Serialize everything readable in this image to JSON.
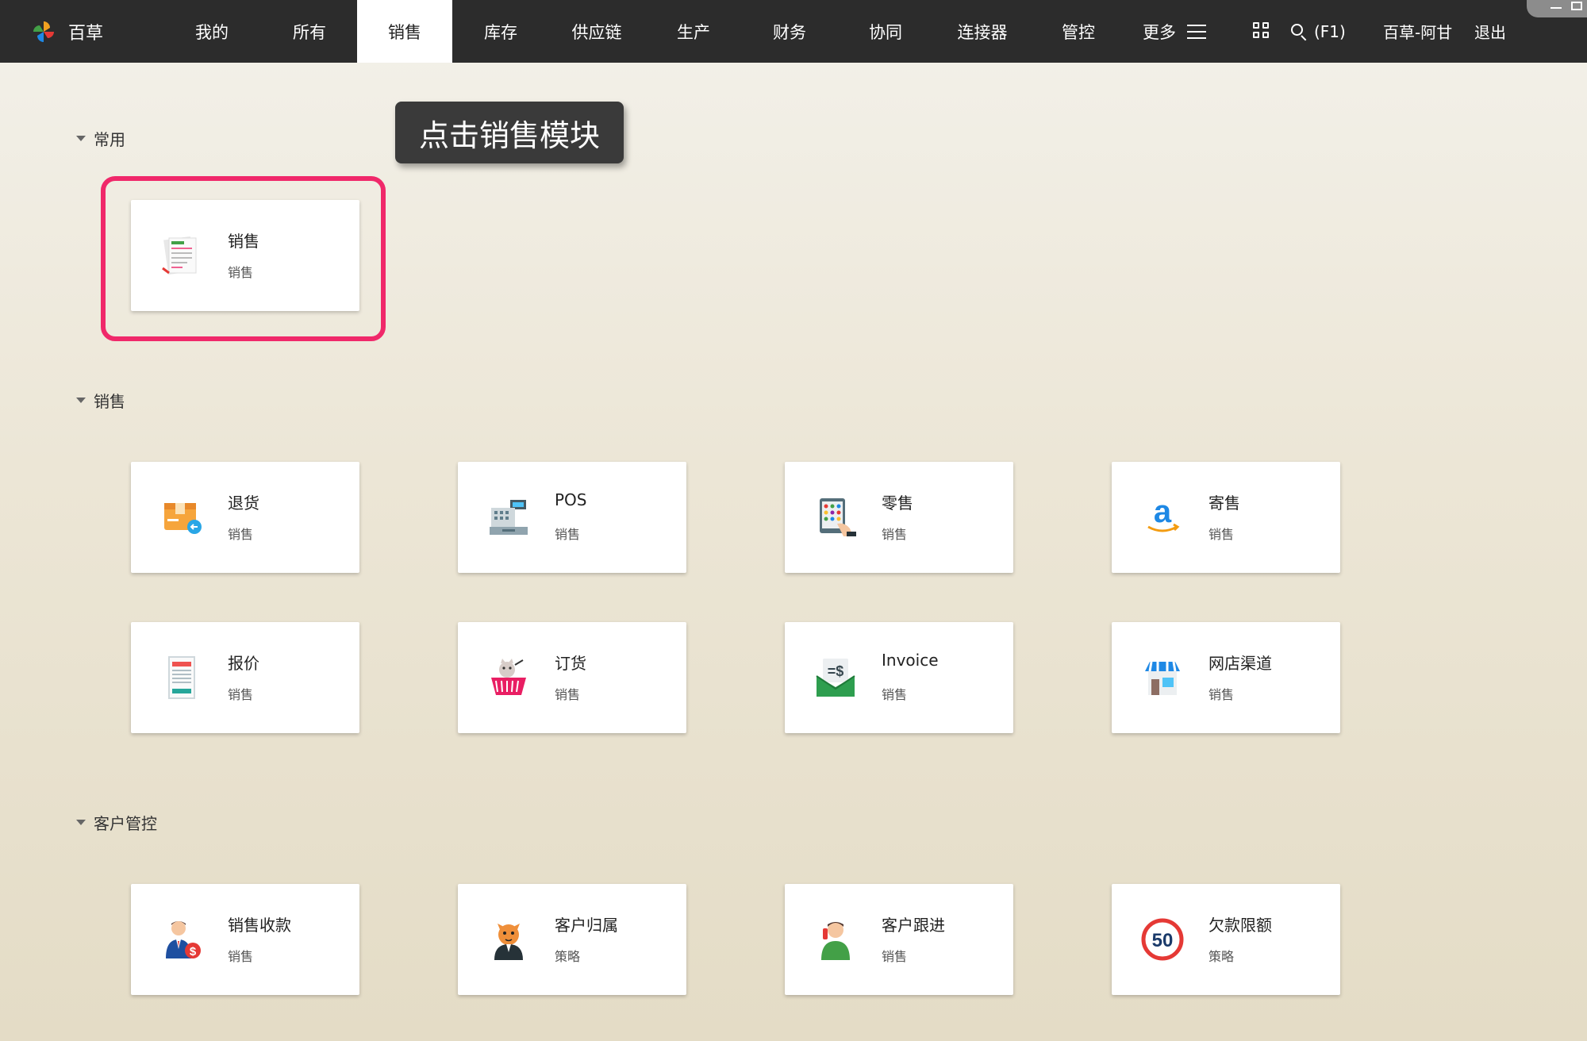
{
  "brand": {
    "name": "百草"
  },
  "nav": {
    "tabs": [
      {
        "label": "我的"
      },
      {
        "label": "所有"
      },
      {
        "label": "销售"
      },
      {
        "label": "库存"
      },
      {
        "label": "供应链"
      },
      {
        "label": "生产"
      },
      {
        "label": "财务"
      },
      {
        "label": "协同"
      },
      {
        "label": "连接器"
      },
      {
        "label": "管控"
      }
    ],
    "active_tab": "销售",
    "more_label": "更多",
    "search_hint": "(F1)",
    "user": "百草-阿甘",
    "logout": "退出"
  },
  "tooltip": {
    "text": "点击销售模块"
  },
  "sections": [
    {
      "title": "常用",
      "cards": [
        {
          "title": "销售",
          "sub": "销售",
          "icon": "order-document-icon"
        }
      ]
    },
    {
      "title": "销售",
      "cards": [
        {
          "title": "退货",
          "sub": "销售",
          "icon": "return-box-icon"
        },
        {
          "title": "POS",
          "sub": "销售",
          "icon": "cash-register-icon"
        },
        {
          "title": "零售",
          "sub": "销售",
          "icon": "tablet-hand-icon"
        },
        {
          "title": "寄售",
          "sub": "销售",
          "icon": "amazon-logo-icon"
        },
        {
          "title": "报价",
          "sub": "销售",
          "icon": "price-tag-icon"
        },
        {
          "title": "订货",
          "sub": "销售",
          "icon": "shopping-basket-icon"
        },
        {
          "title": "Invoice",
          "sub": "销售",
          "icon": "invoice-envelope-icon"
        },
        {
          "title": "网店渠道",
          "sub": "销售",
          "icon": "storefront-icon"
        }
      ]
    },
    {
      "title": "客户管控",
      "cards": [
        {
          "title": "销售收款",
          "sub": "销售",
          "icon": "salesman-dollar-icon"
        },
        {
          "title": "客户归属",
          "sub": "策略",
          "icon": "cat-mascot-icon"
        },
        {
          "title": "客户跟进",
          "sub": "销售",
          "icon": "person-phone-icon"
        },
        {
          "title": "欠款限额",
          "sub": "策略",
          "icon": "speed-limit-icon"
        }
      ]
    }
  ],
  "colors": {
    "topbar": "#2c2c2c",
    "highlight": "#f0286a",
    "tooltip": "#3a3a3a"
  }
}
